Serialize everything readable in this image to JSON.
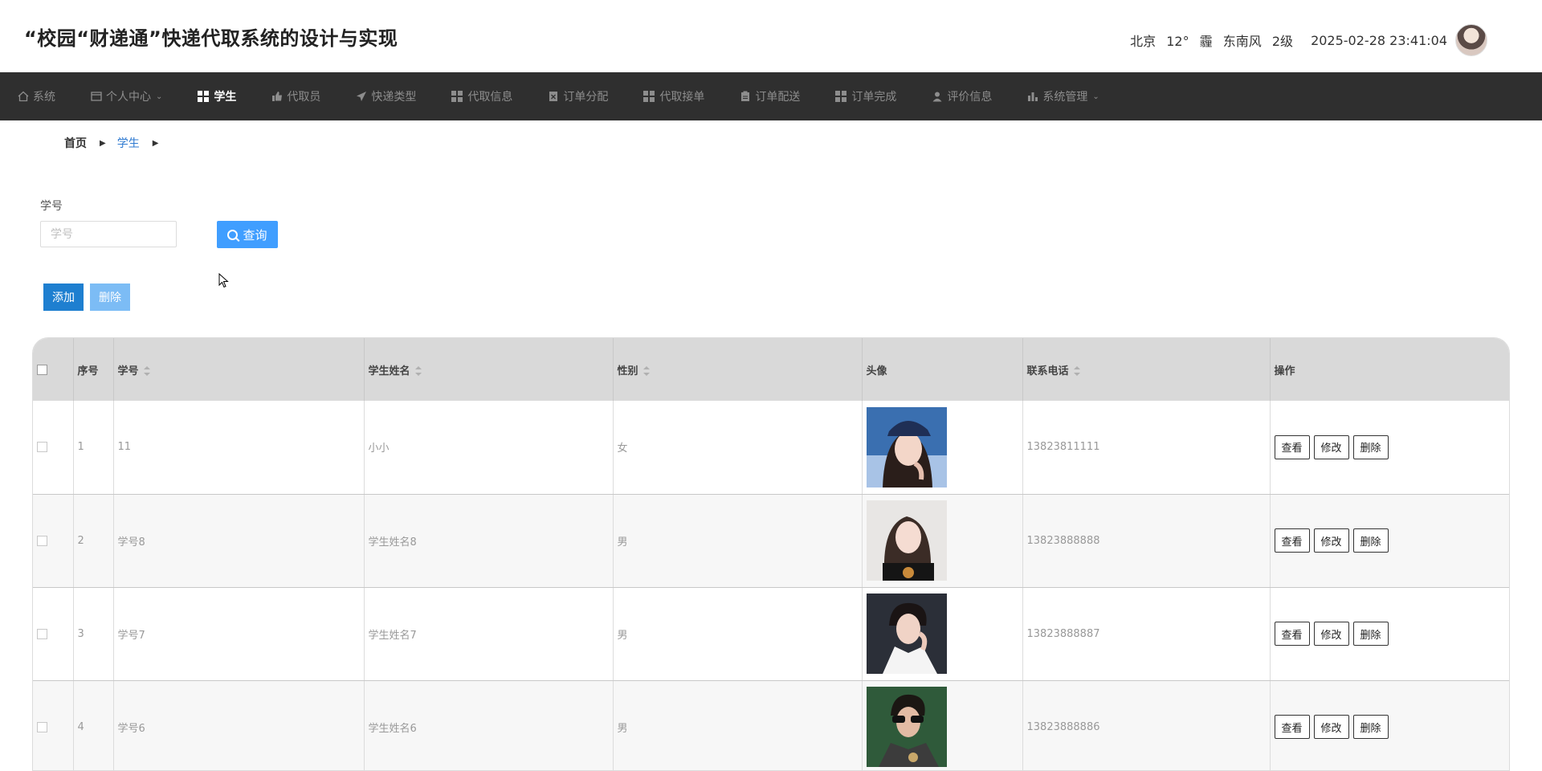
{
  "header": {
    "title": "“校园“财递通”快递代取系统的设计与实现",
    "weather_city": "北京",
    "weather_temp": "12°",
    "weather_cond": "霾",
    "weather_wind": "东南风",
    "weather_level": "2级",
    "datetime": "2025-02-28 23:41:04"
  },
  "nav": {
    "items": [
      {
        "label": "系统",
        "icon": "home-icon"
      },
      {
        "label": "个人中心",
        "icon": "card-icon",
        "dropdown": true
      },
      {
        "label": "学生",
        "icon": "grid-icon",
        "active": true
      },
      {
        "label": "代取员",
        "icon": "thumb-icon"
      },
      {
        "label": "快递类型",
        "icon": "plane-icon"
      },
      {
        "label": "代取信息",
        "icon": "grid-icon"
      },
      {
        "label": "订单分配",
        "icon": "doc-x-icon"
      },
      {
        "label": "代取接单",
        "icon": "grid-icon"
      },
      {
        "label": "订单配送",
        "icon": "clipboard-icon"
      },
      {
        "label": "订单完成",
        "icon": "grid-icon"
      },
      {
        "label": "评价信息",
        "icon": "user-icon"
      },
      {
        "label": "系统管理",
        "icon": "bar-chart-icon",
        "dropdown": true
      }
    ]
  },
  "breadcrumb": {
    "home": "首页",
    "current": "学生"
  },
  "search": {
    "label": "学号",
    "placeholder": "学号",
    "button": "查询"
  },
  "actions": {
    "add": "添加",
    "delete": "删除"
  },
  "table": {
    "headers": {
      "index": "序号",
      "student_no": "学号",
      "name": "学生姓名",
      "gender": "性别",
      "avatar": "头像",
      "phone": "联系电话",
      "ops": "操作"
    },
    "op_labels": {
      "view": "查看",
      "edit": "修改",
      "delete": "删除"
    },
    "rows": [
      {
        "index": "1",
        "student_no": "11",
        "name": "小小",
        "gender": "女",
        "phone": "13823811111"
      },
      {
        "index": "2",
        "student_no": "学号8",
        "name": "学生姓名8",
        "gender": "男",
        "phone": "13823888888"
      },
      {
        "index": "3",
        "student_no": "学号7",
        "name": "学生姓名7",
        "gender": "男",
        "phone": "13823888887"
      },
      {
        "index": "4",
        "student_no": "学号6",
        "name": "学生姓名6",
        "gender": "男",
        "phone": "13823888886"
      }
    ]
  },
  "colors": {
    "nav_bg": "#2f2f2f",
    "primary": "#409eff",
    "add_button": "#1e7fd0",
    "delete_button": "#7cbcf5",
    "breadcrumb_current": "#2e7ad1"
  }
}
